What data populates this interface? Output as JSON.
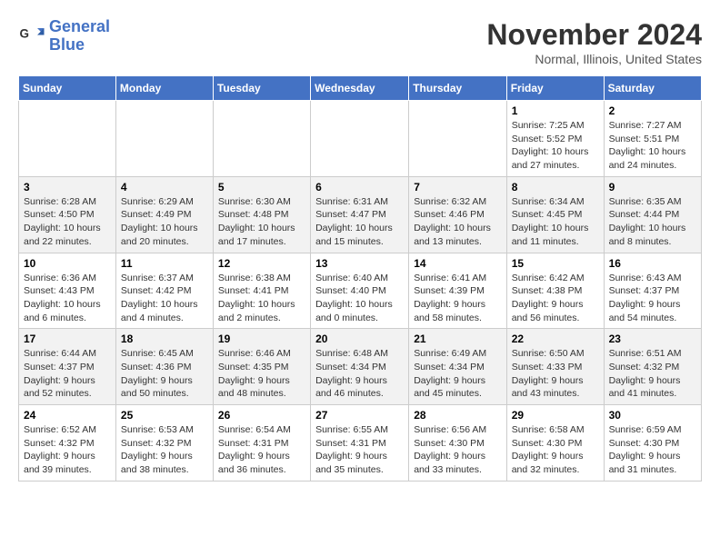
{
  "header": {
    "logo_line1": "General",
    "logo_line2": "Blue",
    "month": "November 2024",
    "location": "Normal, Illinois, United States"
  },
  "weekdays": [
    "Sunday",
    "Monday",
    "Tuesday",
    "Wednesday",
    "Thursday",
    "Friday",
    "Saturday"
  ],
  "weeks": [
    [
      {
        "day": "",
        "info": ""
      },
      {
        "day": "",
        "info": ""
      },
      {
        "day": "",
        "info": ""
      },
      {
        "day": "",
        "info": ""
      },
      {
        "day": "",
        "info": ""
      },
      {
        "day": "1",
        "info": "Sunrise: 7:25 AM\nSunset: 5:52 PM\nDaylight: 10 hours\nand 27 minutes."
      },
      {
        "day": "2",
        "info": "Sunrise: 7:27 AM\nSunset: 5:51 PM\nDaylight: 10 hours\nand 24 minutes."
      }
    ],
    [
      {
        "day": "3",
        "info": "Sunrise: 6:28 AM\nSunset: 4:50 PM\nDaylight: 10 hours\nand 22 minutes."
      },
      {
        "day": "4",
        "info": "Sunrise: 6:29 AM\nSunset: 4:49 PM\nDaylight: 10 hours\nand 20 minutes."
      },
      {
        "day": "5",
        "info": "Sunrise: 6:30 AM\nSunset: 4:48 PM\nDaylight: 10 hours\nand 17 minutes."
      },
      {
        "day": "6",
        "info": "Sunrise: 6:31 AM\nSunset: 4:47 PM\nDaylight: 10 hours\nand 15 minutes."
      },
      {
        "day": "7",
        "info": "Sunrise: 6:32 AM\nSunset: 4:46 PM\nDaylight: 10 hours\nand 13 minutes."
      },
      {
        "day": "8",
        "info": "Sunrise: 6:34 AM\nSunset: 4:45 PM\nDaylight: 10 hours\nand 11 minutes."
      },
      {
        "day": "9",
        "info": "Sunrise: 6:35 AM\nSunset: 4:44 PM\nDaylight: 10 hours\nand 8 minutes."
      }
    ],
    [
      {
        "day": "10",
        "info": "Sunrise: 6:36 AM\nSunset: 4:43 PM\nDaylight: 10 hours\nand 6 minutes."
      },
      {
        "day": "11",
        "info": "Sunrise: 6:37 AM\nSunset: 4:42 PM\nDaylight: 10 hours\nand 4 minutes."
      },
      {
        "day": "12",
        "info": "Sunrise: 6:38 AM\nSunset: 4:41 PM\nDaylight: 10 hours\nand 2 minutes."
      },
      {
        "day": "13",
        "info": "Sunrise: 6:40 AM\nSunset: 4:40 PM\nDaylight: 10 hours\nand 0 minutes."
      },
      {
        "day": "14",
        "info": "Sunrise: 6:41 AM\nSunset: 4:39 PM\nDaylight: 9 hours\nand 58 minutes."
      },
      {
        "day": "15",
        "info": "Sunrise: 6:42 AM\nSunset: 4:38 PM\nDaylight: 9 hours\nand 56 minutes."
      },
      {
        "day": "16",
        "info": "Sunrise: 6:43 AM\nSunset: 4:37 PM\nDaylight: 9 hours\nand 54 minutes."
      }
    ],
    [
      {
        "day": "17",
        "info": "Sunrise: 6:44 AM\nSunset: 4:37 PM\nDaylight: 9 hours\nand 52 minutes."
      },
      {
        "day": "18",
        "info": "Sunrise: 6:45 AM\nSunset: 4:36 PM\nDaylight: 9 hours\nand 50 minutes."
      },
      {
        "day": "19",
        "info": "Sunrise: 6:46 AM\nSunset: 4:35 PM\nDaylight: 9 hours\nand 48 minutes."
      },
      {
        "day": "20",
        "info": "Sunrise: 6:48 AM\nSunset: 4:34 PM\nDaylight: 9 hours\nand 46 minutes."
      },
      {
        "day": "21",
        "info": "Sunrise: 6:49 AM\nSunset: 4:34 PM\nDaylight: 9 hours\nand 45 minutes."
      },
      {
        "day": "22",
        "info": "Sunrise: 6:50 AM\nSunset: 4:33 PM\nDaylight: 9 hours\nand 43 minutes."
      },
      {
        "day": "23",
        "info": "Sunrise: 6:51 AM\nSunset: 4:32 PM\nDaylight: 9 hours\nand 41 minutes."
      }
    ],
    [
      {
        "day": "24",
        "info": "Sunrise: 6:52 AM\nSunset: 4:32 PM\nDaylight: 9 hours\nand 39 minutes."
      },
      {
        "day": "25",
        "info": "Sunrise: 6:53 AM\nSunset: 4:32 PM\nDaylight: 9 hours\nand 38 minutes."
      },
      {
        "day": "26",
        "info": "Sunrise: 6:54 AM\nSunset: 4:31 PM\nDaylight: 9 hours\nand 36 minutes."
      },
      {
        "day": "27",
        "info": "Sunrise: 6:55 AM\nSunset: 4:31 PM\nDaylight: 9 hours\nand 35 minutes."
      },
      {
        "day": "28",
        "info": "Sunrise: 6:56 AM\nSunset: 4:30 PM\nDaylight: 9 hours\nand 33 minutes."
      },
      {
        "day": "29",
        "info": "Sunrise: 6:58 AM\nSunset: 4:30 PM\nDaylight: 9 hours\nand 32 minutes."
      },
      {
        "day": "30",
        "info": "Sunrise: 6:59 AM\nSunset: 4:30 PM\nDaylight: 9 hours\nand 31 minutes."
      }
    ]
  ]
}
